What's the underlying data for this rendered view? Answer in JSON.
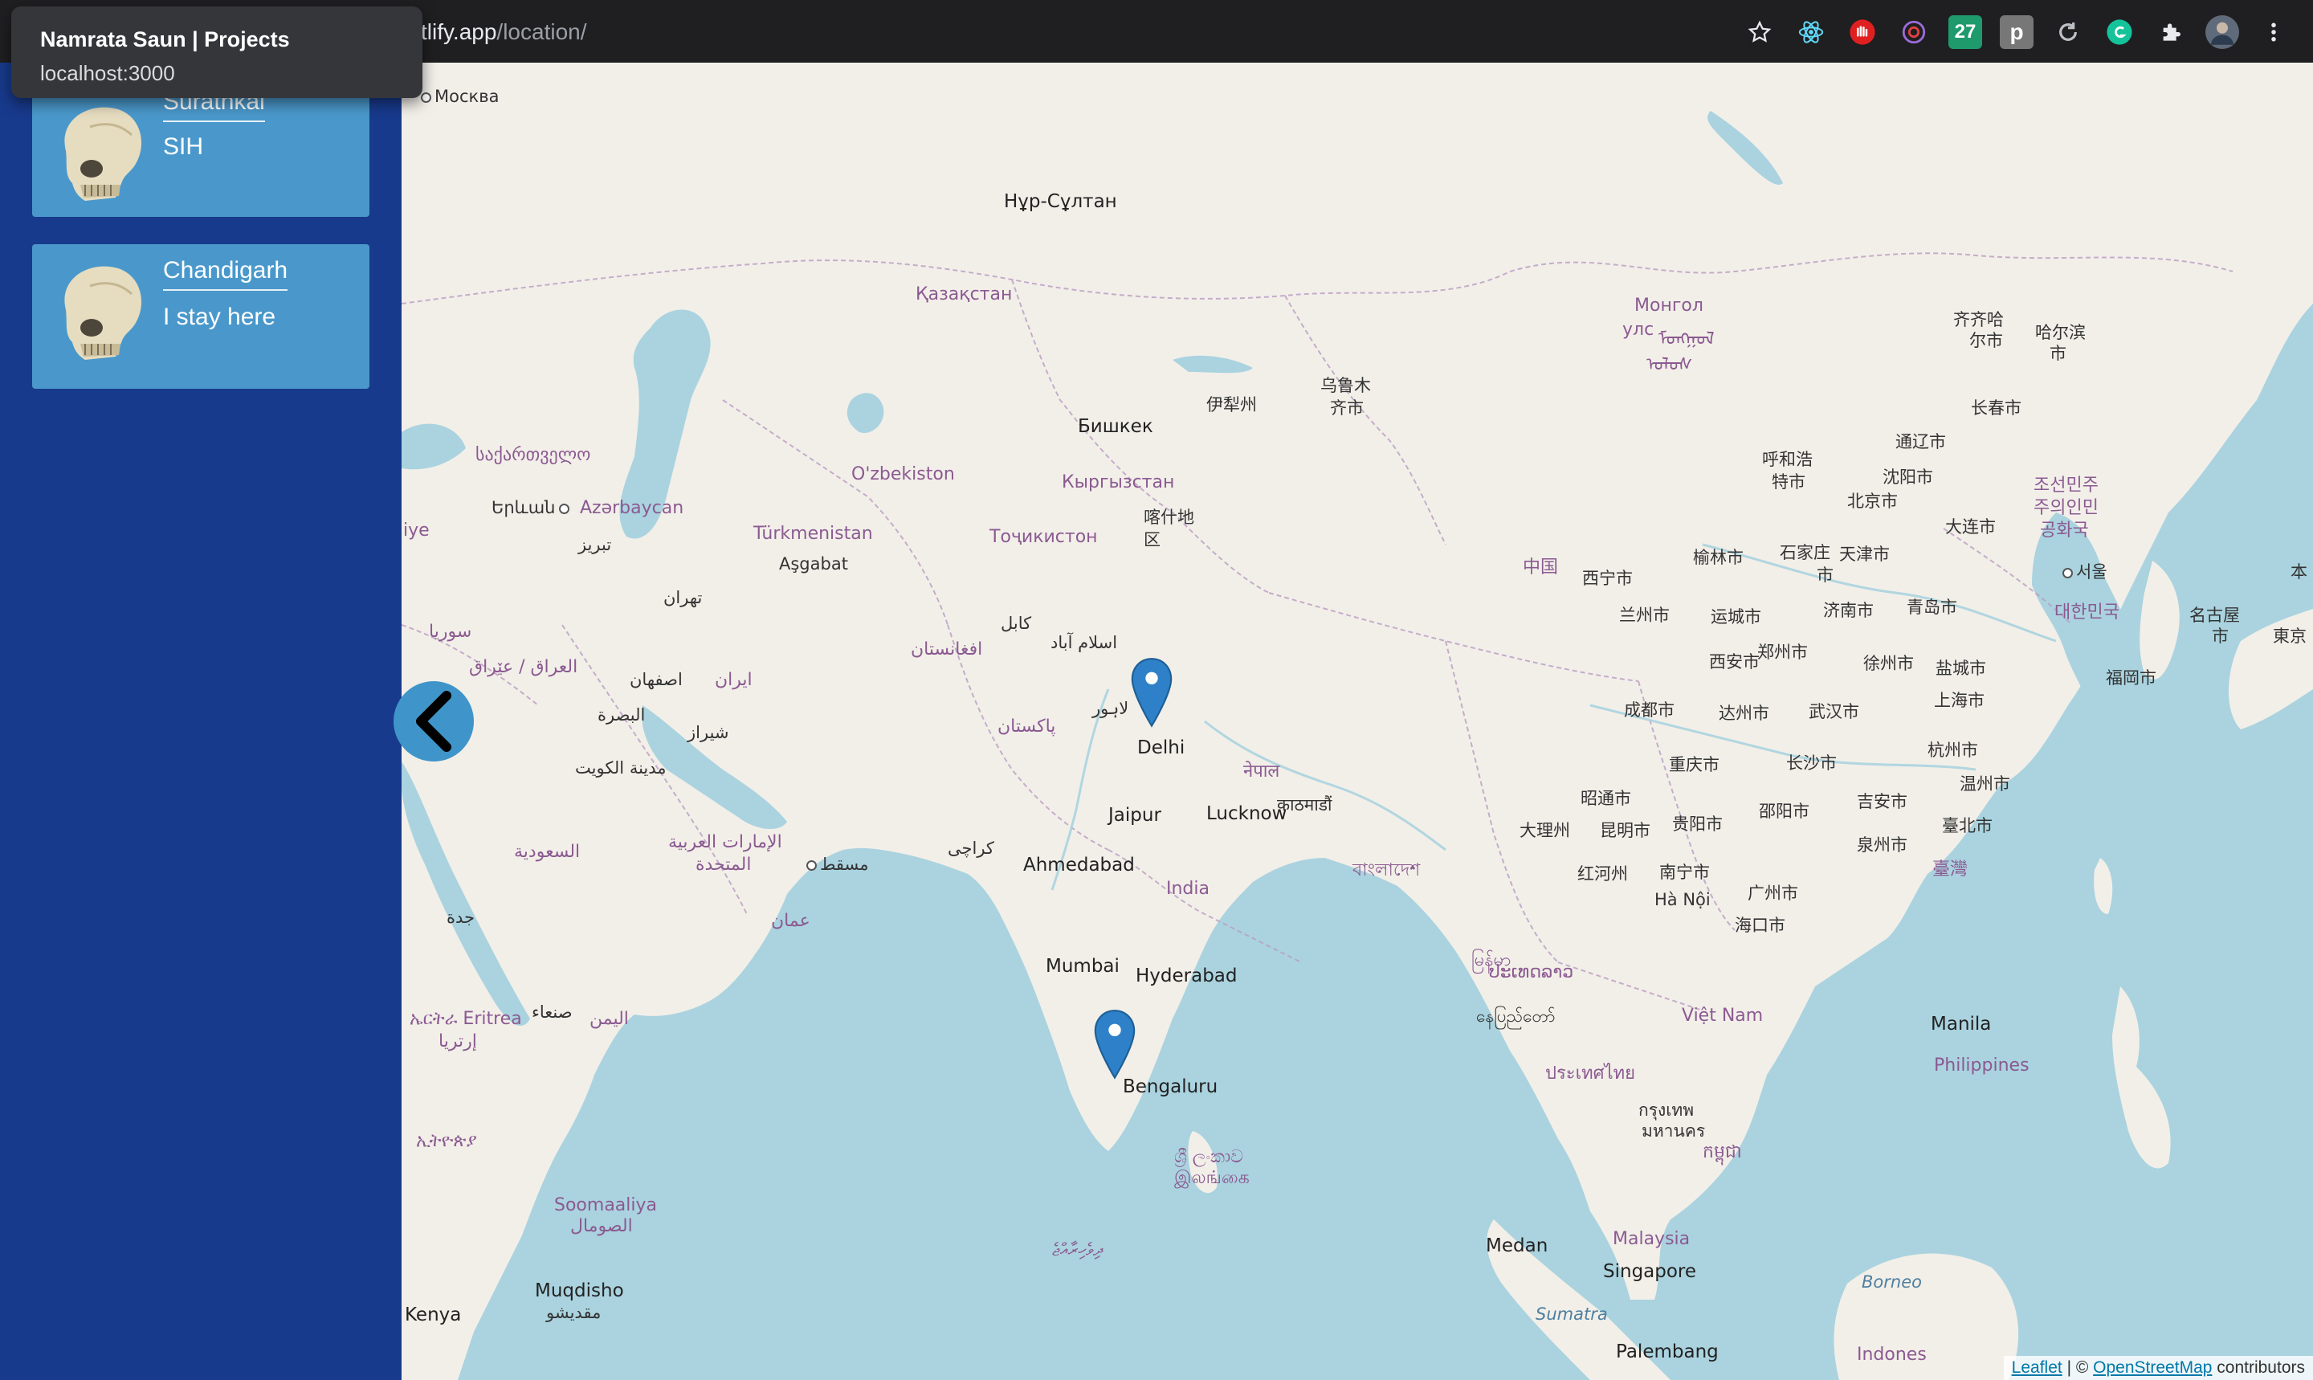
{
  "browser": {
    "url_prefix": "tlify.app",
    "url_path": "/location/",
    "tooltip_title": "Namrata Saun | Projects",
    "tooltip_host": "localhost:3000",
    "extensions": [
      "star-icon",
      "react-devtools-icon",
      "red-hand-icon",
      "redux-icon",
      "27-icon",
      "p-icon",
      "refresh-icon",
      "grammarly-icon",
      "puzzle-icon",
      "avatar",
      "menu-icon"
    ],
    "ext_27": "27",
    "ext_p": "p"
  },
  "sidebar": {
    "background": "#183a8c",
    "card_color": "#4a98cb",
    "cards": [
      {
        "place": "Surathkal",
        "desc": "SIH"
      },
      {
        "place": "Chandigarh",
        "desc": "I stay here"
      }
    ]
  },
  "map": {
    "labels": {
      "moskva": "Москва",
      "nursultan": "Нұр-Сұлтан",
      "kazakhstan": "Қазақстан",
      "mongol": "Монгол",
      "mongol2": "ᠮᠣᠩᠭᠣᠯ",
      "mongol3": "ᠤᠯᠤᠰ",
      "ulus": "улс",
      "qiqihar": "齐齐哈",
      "qiqihar2": "尔市",
      "harbin": "哈尔滨",
      "harbin2": "市",
      "yining": "伊犁州",
      "urumqi": "乌鲁木",
      "urumqi2": "齐市",
      "changchun": "长春市",
      "bishkek": "Бишкек",
      "hohhot": "呼和浩",
      "hohhot2": "特市",
      "tonghua": "通辽市",
      "georgia": "საქართველო",
      "uzbekistan": "O'zbekiston",
      "kyrgyz": "Кыргызстан",
      "shenyang": "沈阳市",
      "nkorea": "조선민주",
      "nkorea2": "주의인민",
      "nkorea3": "공화국",
      "yerevan": "Երևան",
      "azerbaijan": "Azərbaycan",
      "kashgar": "喀什地",
      "kashgar2": "区",
      "beijing": "北京市",
      "turkmenistan": "Türkmenistan",
      "tajik": "Тоҷикистон",
      "dalian": "大连市",
      "tabriz": "تبریز",
      "ashgabat": "Aşgabat",
      "china": "中国",
      "xining": "西宁市",
      "yulin": "榆林市",
      "shijiazhuang": "石家庄",
      "shijiazhuang2": "市",
      "tianjin": "天津市",
      "seoul": "서울",
      "tehran": "تهران",
      "lanzhou": "兰州市",
      "jinan": "济南市",
      "qingdao": "青岛市",
      "skorea": "대한민국",
      "kabul": "کابل",
      "yuncheng": "运城市",
      "syria": "سوریا",
      "islamabad": "اسلام آباد",
      "afghanistan": "افغانستان",
      "zhengzhou": "郑州市",
      "xian": "西安市",
      "xuzhou": "徐州市",
      "yancheng": "盐城市",
      "iraq": "العراق / عێراق",
      "isfahan": "اصفهان",
      "iran": "ایران",
      "lahore": "لاہور",
      "chengdu": "成都市",
      "dazhou": "达州市",
      "wuhan": "武汉市",
      "shanghai": "上海市",
      "fukuoka": "福岡市",
      "basra": "البصرة",
      "pakistan": "پاکستان",
      "shiraz": "شیراز",
      "delhi": "Delhi",
      "nepal": "नेपाल",
      "chongqing": "重庆市",
      "changsha": "长沙市",
      "hangzhou": "杭州市",
      "kuwait": "مدينة الكويت",
      "kathmandu": "काठमाडौं",
      "zhaotong": "昭通市",
      "wenzhou": "温州市",
      "jaipur": "Jaipur",
      "lucknow": "Lucknow",
      "shaoyang": "邵阳市",
      "jian": "吉安市",
      "dali": "大理州",
      "kunming": "昆明市",
      "guiyang": "贵阳市",
      "taipei": "臺北市",
      "karachi": "كراچی",
      "uae": "الإمارات العربية",
      "uae2": "المتحدة",
      "muscat": "مسقط",
      "quanzhou": "泉州市",
      "saudi": "السعودية",
      "ahmedabad": "Ahmedabad",
      "bangladesh": "বাংলাদেশ",
      "taiwan": "臺灣",
      "honghe": "红河州",
      "nanning": "南宁市",
      "guangzhou": "广州市",
      "india": "India",
      "oman": "عمان",
      "hanoi": "Hà Nội",
      "jeddah": "جدة",
      "haikou": "海口市",
      "mumbai": "Mumbai",
      "hyderabad": "Hyderabad",
      "myanmar": "မြန်မာ",
      "laos": "ປະເທດລາວ",
      "sanaa": "صنعاء",
      "yemen": "اليمن",
      "vietnam": "Việt Nam",
      "eritrea": "ኤርትራ Eritrea",
      "eritrea2": "إرتريا",
      "manila": "Manila",
      "naypyidaw": "နေပြည်တော်",
      "thailand": "ประเทศไทย",
      "philippines": "Philippines",
      "bengaluru": "Bengaluru",
      "ethiopia": "ኢትዮጵያ",
      "bangkok": "กรุงเทพ",
      "bangkok2": "มหานคร",
      "cambodia": "កម្ពុជា",
      "srilanka": "ශ්‍රී ලංකාව",
      "srilanka2": "இலங்கை",
      "somalia": "Soomaaliya",
      "somalia2": "الصومال",
      "maldives": "ދިވެހިރާއްޖެ",
      "medan": "Medan",
      "malaysia": "Malaysia",
      "singapore": "Singapore",
      "borneo": "Borneo",
      "mogadishu": "Muqdisho",
      "mogadishu2": "مقديشو",
      "sumatra": "Sumatra",
      "kenya": "Kenya",
      "palembang": "Palembang",
      "indonesia": "Indones",
      "iye": "iye",
      "japan": "本",
      "nagoya": "名古屋",
      "nagoya2": "市",
      "tokyo": "東京"
    },
    "markers": [
      "Chandigarh",
      "Surathkal"
    ],
    "attribution": {
      "leaflet": "Leaflet",
      "sep": " | © ",
      "osm": "OpenStreetMap",
      "suffix": " contributors"
    }
  }
}
